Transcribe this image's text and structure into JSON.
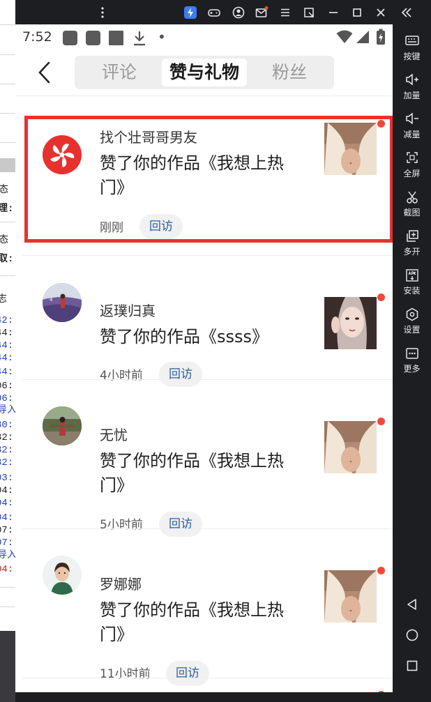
{
  "host_background": {
    "fragments": [
      "态",
      "理:",
      "态",
      "取:",
      "志",
      "42:",
      "44:",
      "44:",
      "44:",
      "44:",
      "06:",
      "06:",
      "导入",
      "30:",
      "32:",
      "32:",
      "32:",
      "03:",
      "04:",
      "04:",
      "04:",
      "07:",
      "07:",
      "导入",
      "04:"
    ],
    "colors": {
      "blue": "#2340c8",
      "red": "#d21f1f",
      "dark": "#222222"
    }
  },
  "emulator": {
    "titlebar": {
      "icons": [
        "more-vert-icon",
        "bolt-icon",
        "gamepad-icon",
        "account-icon",
        "mail-icon",
        "menu-icon",
        "resize-icon",
        "minimize-icon",
        "maximize-icon",
        "close-icon",
        "collapse-icon"
      ]
    },
    "sidebar": {
      "items": [
        {
          "icon": "keyboard-icon",
          "label": "按键"
        },
        {
          "icon": "volume-up-icon",
          "label": "加量"
        },
        {
          "icon": "volume-down-icon",
          "label": "减量"
        },
        {
          "icon": "fullscreen-icon",
          "label": "全屏"
        },
        {
          "icon": "scissors-icon",
          "label": "截图"
        },
        {
          "icon": "multi-open-icon",
          "label": "多开"
        },
        {
          "icon": "apk-install-icon",
          "label": "安装"
        },
        {
          "icon": "settings-icon",
          "label": "设置"
        },
        {
          "icon": "more-icon",
          "label": "更多"
        }
      ],
      "nav": [
        "back-triangle-icon",
        "home-circle-icon",
        "recents-square-icon"
      ]
    }
  },
  "phone": {
    "status_bar": {
      "time": "7:52",
      "dot": "•"
    },
    "tabs": [
      {
        "label": "评论",
        "active": false
      },
      {
        "label": "赞与礼物",
        "active": true
      },
      {
        "label": "粉丝",
        "active": false
      }
    ],
    "notifications": [
      {
        "name": "找个壮哥哥男友",
        "action": "赞了你的作品《我想上热门》",
        "time": "刚刚",
        "revisit": "回访",
        "highlighted": true
      },
      {
        "name": "返璞归真",
        "action": "赞了你的作品《ssss》",
        "time": "4小时前",
        "revisit": "回访",
        "highlighted": false
      },
      {
        "name": "无忧",
        "action": "赞了你的作品《我想上热门》",
        "time": "5小时前",
        "revisit": "回访",
        "highlighted": false
      },
      {
        "name": "罗娜娜",
        "action": "赞了你的作品《我想上热门》",
        "time": "11小时前",
        "revisit": "回访",
        "highlighted": false
      }
    ],
    "colors": {
      "accent_red": "#e8312f",
      "unread_dot": "#f0493c",
      "revisit_text": "#2a5d9f"
    }
  }
}
